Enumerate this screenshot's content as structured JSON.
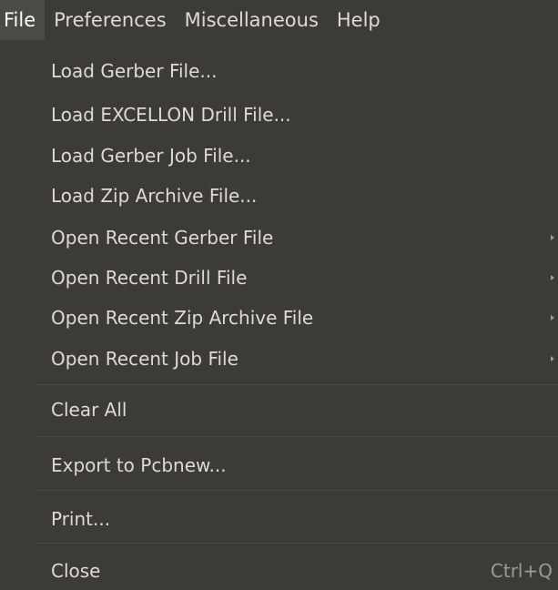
{
  "menubar": {
    "items": [
      {
        "label": "File"
      },
      {
        "label": "Preferences"
      },
      {
        "label": "Miscellaneous"
      },
      {
        "label": "Help"
      }
    ]
  },
  "file_menu": {
    "items": [
      {
        "label": "Load Gerber File..."
      },
      {
        "label": "Load EXCELLON Drill File..."
      },
      {
        "label": "Load Gerber Job File..."
      },
      {
        "label": "Load Zip Archive File..."
      },
      {
        "label": "Open Recent Gerber File"
      },
      {
        "label": "Open Recent Drill File"
      },
      {
        "label": "Open Recent Zip Archive File"
      },
      {
        "label": "Open Recent Job File"
      },
      {
        "label": "Clear All"
      },
      {
        "label": "Export to Pcbnew..."
      },
      {
        "label": "Print..."
      },
      {
        "label": "Close",
        "shortcut": "Ctrl+Q"
      }
    ]
  },
  "colors": {
    "background": "#3c3b37",
    "active_menu": "#4b4a45",
    "text": "#dfdbd2",
    "shortcut_text": "#9e9b93"
  }
}
